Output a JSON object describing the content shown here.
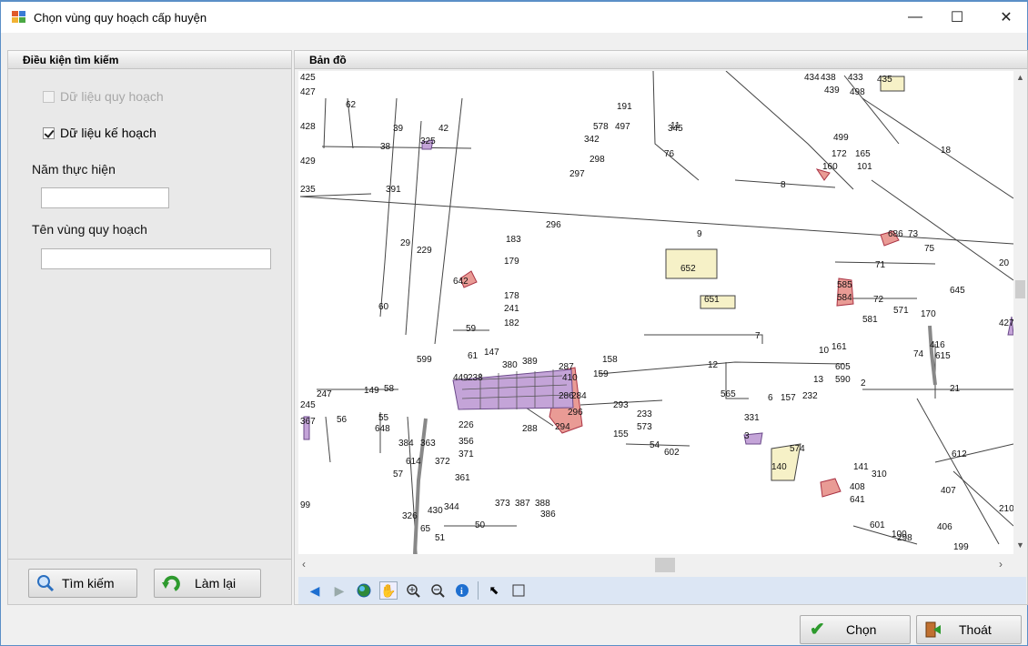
{
  "window": {
    "title": "Chọn vùng quy hoạch cấp huyện",
    "minimize": "—",
    "maximize": "☐",
    "close": "✕"
  },
  "left_panel": {
    "header": "Điều kiện tìm kiếm",
    "chk_quy_hoach": "Dữ liệu quy hoạch",
    "chk_ke_hoach": "Dữ liệu kế hoạch",
    "year_label": "Năm thực hiện",
    "year_value": "",
    "zone_label": "Tên vùng quy hoạch",
    "zone_value": "",
    "search_button": "Tìm kiếm",
    "reset_button": "Làm lại"
  },
  "map_panel": {
    "header": "Bản đồ",
    "labels": [
      "425",
      "427",
      "62",
      "428",
      "429",
      "235",
      "38",
      "39",
      "325",
      "42",
      "391",
      "191",
      "578",
      "497",
      "342",
      "345",
      "298",
      "297",
      "76",
      "499",
      "172",
      "165",
      "160",
      "101",
      "18",
      "434",
      "438",
      "433",
      "435",
      "439",
      "498",
      "8",
      "296",
      "183",
      "9",
      "686",
      "73",
      "75",
      "29",
      "229",
      "179",
      "652",
      "71",
      "20",
      "642",
      "178",
      "241",
      "182",
      "651",
      "585",
      "584",
      "72",
      "645",
      "60",
      "571",
      "170",
      "581",
      "59",
      "427",
      "147",
      "61",
      "7",
      "599",
      "380",
      "389",
      "158",
      "159",
      "12",
      "161",
      "10",
      "605",
      "590",
      "13",
      "74",
      "416",
      "615",
      "21",
      "449",
      "238",
      "287",
      "247",
      "149",
      "58",
      "245",
      "56",
      "55",
      "367",
      "410",
      "286",
      "284",
      "293",
      "296",
      "233",
      "573",
      "565",
      "157",
      "232",
      "155",
      "294",
      "288",
      "226",
      "648",
      "384",
      "363",
      "356",
      "371",
      "372",
      "614",
      "57",
      "361",
      "602",
      "574",
      "140",
      "141",
      "310",
      "408",
      "641",
      "407",
      "99",
      "430",
      "344",
      "373",
      "387",
      "388",
      "386",
      "326",
      "65",
      "51",
      "50",
      "601",
      "100",
      "406",
      "298",
      "199",
      "210",
      "612",
      "54",
      "6",
      "3",
      "331",
      "2",
      "11"
    ]
  },
  "footer": {
    "choose_button": "Chọn",
    "exit_button": "Thoát"
  }
}
